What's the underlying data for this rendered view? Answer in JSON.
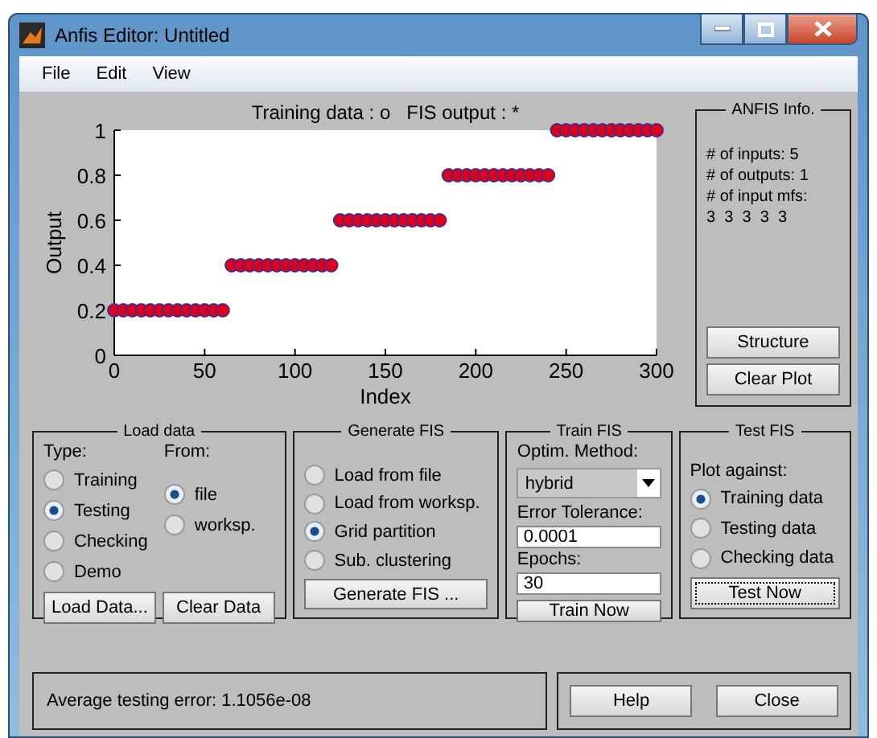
{
  "window": {
    "title": "Anfis Editor: Untitled"
  },
  "menu": [
    "File",
    "Edit",
    "View"
  ],
  "plot": {
    "chart_data": {
      "type": "scatter",
      "title": "Training data : o   FIS output : *",
      "xlabel": "Index",
      "ylabel": "Output",
      "xlim": [
        0,
        300
      ],
      "ylim": [
        0,
        1
      ],
      "xticks": [
        0,
        50,
        100,
        150,
        200,
        250,
        300
      ],
      "yticks": [
        0,
        0.2,
        0.4,
        0.6,
        0.8,
        1
      ],
      "x": [
        0,
        5,
        10,
        15,
        20,
        25,
        30,
        35,
        40,
        45,
        50,
        55,
        60,
        65,
        70,
        75,
        80,
        85,
        90,
        95,
        100,
        105,
        110,
        115,
        120,
        125,
        130,
        135,
        140,
        145,
        150,
        155,
        160,
        165,
        170,
        175,
        180,
        185,
        190,
        195,
        200,
        205,
        210,
        215,
        220,
        225,
        230,
        235,
        240,
        245,
        250,
        255,
        260,
        265,
        270,
        275,
        280,
        285,
        290,
        295,
        300
      ],
      "series": [
        {
          "color": "#e0001a",
          "values": [
            0.2,
            0.2,
            0.2,
            0.2,
            0.2,
            0.2,
            0.2,
            0.2,
            0.2,
            0.2,
            0.2,
            0.2,
            0.2,
            0.4,
            0.4,
            0.4,
            0.4,
            0.4,
            0.4,
            0.4,
            0.4,
            0.4,
            0.4,
            0.4,
            0.4,
            0.6,
            0.6,
            0.6,
            0.6,
            0.6,
            0.6,
            0.6,
            0.6,
            0.6,
            0.6,
            0.6,
            0.6,
            0.8,
            0.8,
            0.8,
            0.8,
            0.8,
            0.8,
            0.8,
            0.8,
            0.8,
            0.8,
            0.8,
            0.8,
            1,
            1,
            1,
            1,
            1,
            1,
            1,
            1,
            1,
            1,
            1,
            1
          ]
        }
      ]
    }
  },
  "anfis_info": {
    "title": "ANFIS Info.",
    "lines": [
      "# of inputs: 5",
      "# of outputs: 1",
      "# of input mfs:",
      "3  3  3  3  3"
    ],
    "buttons": [
      "Structure",
      "Clear Plot"
    ]
  },
  "load_data": {
    "title": "Load data",
    "type_label": "Type:",
    "from_label": "From:",
    "types": [
      {
        "label": "Training",
        "selected": false
      },
      {
        "label": "Testing",
        "selected": true
      },
      {
        "label": "Checking",
        "selected": false
      },
      {
        "label": "Demo",
        "selected": false
      }
    ],
    "sources": [
      {
        "label": "file",
        "selected": true
      },
      {
        "label": "worksp.",
        "selected": false
      }
    ],
    "buttons": [
      "Load Data...",
      "Clear Data"
    ]
  },
  "generate_fis": {
    "title": "Generate FIS",
    "options": [
      {
        "label": "Load from file",
        "selected": false
      },
      {
        "label": "Load from worksp.",
        "selected": false
      },
      {
        "label": "Grid partition",
        "selected": true
      },
      {
        "label": "Sub. clustering",
        "selected": false
      }
    ],
    "button": "Generate FIS ..."
  },
  "train_fis": {
    "title": "Train FIS",
    "method_label": "Optim. Method:",
    "method": "hybrid",
    "tolerance_label": "Error Tolerance:",
    "tolerance": "0.0001",
    "epochs_label": "Epochs:",
    "epochs": "30",
    "button": "Train Now"
  },
  "test_fis": {
    "title": "Test FIS",
    "plot_label": "Plot against:",
    "options": [
      {
        "label": "Training data",
        "selected": true
      },
      {
        "label": "Testing data",
        "selected": false
      },
      {
        "label": "Checking data",
        "selected": false
      }
    ],
    "button": {
      "label": "Test Now",
      "focused": true
    }
  },
  "status": "Average testing error: 1.1056e-08",
  "buttons": [
    "Help",
    "Close"
  ]
}
